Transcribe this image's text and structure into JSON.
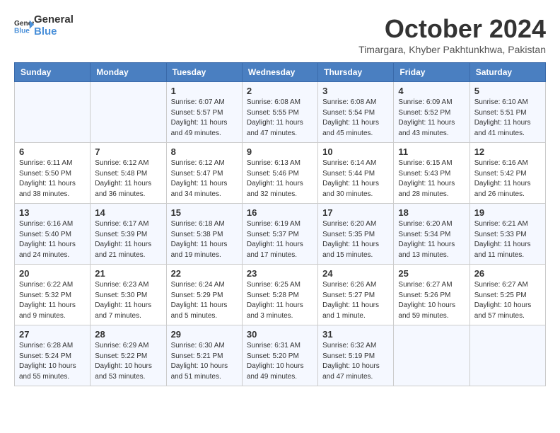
{
  "logo": {
    "text_general": "General",
    "text_blue": "Blue"
  },
  "title": "October 2024",
  "subtitle": "Timargara, Khyber Pakhtunkhwa, Pakistan",
  "days_of_week": [
    "Sunday",
    "Monday",
    "Tuesday",
    "Wednesday",
    "Thursday",
    "Friday",
    "Saturday"
  ],
  "weeks": [
    [
      {
        "day": "",
        "info": ""
      },
      {
        "day": "",
        "info": ""
      },
      {
        "day": "1",
        "info": "Sunrise: 6:07 AM\nSunset: 5:57 PM\nDaylight: 11 hours and 49 minutes."
      },
      {
        "day": "2",
        "info": "Sunrise: 6:08 AM\nSunset: 5:55 PM\nDaylight: 11 hours and 47 minutes."
      },
      {
        "day": "3",
        "info": "Sunrise: 6:08 AM\nSunset: 5:54 PM\nDaylight: 11 hours and 45 minutes."
      },
      {
        "day": "4",
        "info": "Sunrise: 6:09 AM\nSunset: 5:52 PM\nDaylight: 11 hours and 43 minutes."
      },
      {
        "day": "5",
        "info": "Sunrise: 6:10 AM\nSunset: 5:51 PM\nDaylight: 11 hours and 41 minutes."
      }
    ],
    [
      {
        "day": "6",
        "info": "Sunrise: 6:11 AM\nSunset: 5:50 PM\nDaylight: 11 hours and 38 minutes."
      },
      {
        "day": "7",
        "info": "Sunrise: 6:12 AM\nSunset: 5:48 PM\nDaylight: 11 hours and 36 minutes."
      },
      {
        "day": "8",
        "info": "Sunrise: 6:12 AM\nSunset: 5:47 PM\nDaylight: 11 hours and 34 minutes."
      },
      {
        "day": "9",
        "info": "Sunrise: 6:13 AM\nSunset: 5:46 PM\nDaylight: 11 hours and 32 minutes."
      },
      {
        "day": "10",
        "info": "Sunrise: 6:14 AM\nSunset: 5:44 PM\nDaylight: 11 hours and 30 minutes."
      },
      {
        "day": "11",
        "info": "Sunrise: 6:15 AM\nSunset: 5:43 PM\nDaylight: 11 hours and 28 minutes."
      },
      {
        "day": "12",
        "info": "Sunrise: 6:16 AM\nSunset: 5:42 PM\nDaylight: 11 hours and 26 minutes."
      }
    ],
    [
      {
        "day": "13",
        "info": "Sunrise: 6:16 AM\nSunset: 5:40 PM\nDaylight: 11 hours and 24 minutes."
      },
      {
        "day": "14",
        "info": "Sunrise: 6:17 AM\nSunset: 5:39 PM\nDaylight: 11 hours and 21 minutes."
      },
      {
        "day": "15",
        "info": "Sunrise: 6:18 AM\nSunset: 5:38 PM\nDaylight: 11 hours and 19 minutes."
      },
      {
        "day": "16",
        "info": "Sunrise: 6:19 AM\nSunset: 5:37 PM\nDaylight: 11 hours and 17 minutes."
      },
      {
        "day": "17",
        "info": "Sunrise: 6:20 AM\nSunset: 5:35 PM\nDaylight: 11 hours and 15 minutes."
      },
      {
        "day": "18",
        "info": "Sunrise: 6:20 AM\nSunset: 5:34 PM\nDaylight: 11 hours and 13 minutes."
      },
      {
        "day": "19",
        "info": "Sunrise: 6:21 AM\nSunset: 5:33 PM\nDaylight: 11 hours and 11 minutes."
      }
    ],
    [
      {
        "day": "20",
        "info": "Sunrise: 6:22 AM\nSunset: 5:32 PM\nDaylight: 11 hours and 9 minutes."
      },
      {
        "day": "21",
        "info": "Sunrise: 6:23 AM\nSunset: 5:30 PM\nDaylight: 11 hours and 7 minutes."
      },
      {
        "day": "22",
        "info": "Sunrise: 6:24 AM\nSunset: 5:29 PM\nDaylight: 11 hours and 5 minutes."
      },
      {
        "day": "23",
        "info": "Sunrise: 6:25 AM\nSunset: 5:28 PM\nDaylight: 11 hours and 3 minutes."
      },
      {
        "day": "24",
        "info": "Sunrise: 6:26 AM\nSunset: 5:27 PM\nDaylight: 11 hours and 1 minute."
      },
      {
        "day": "25",
        "info": "Sunrise: 6:27 AM\nSunset: 5:26 PM\nDaylight: 10 hours and 59 minutes."
      },
      {
        "day": "26",
        "info": "Sunrise: 6:27 AM\nSunset: 5:25 PM\nDaylight: 10 hours and 57 minutes."
      }
    ],
    [
      {
        "day": "27",
        "info": "Sunrise: 6:28 AM\nSunset: 5:24 PM\nDaylight: 10 hours and 55 minutes."
      },
      {
        "day": "28",
        "info": "Sunrise: 6:29 AM\nSunset: 5:22 PM\nDaylight: 10 hours and 53 minutes."
      },
      {
        "day": "29",
        "info": "Sunrise: 6:30 AM\nSunset: 5:21 PM\nDaylight: 10 hours and 51 minutes."
      },
      {
        "day": "30",
        "info": "Sunrise: 6:31 AM\nSunset: 5:20 PM\nDaylight: 10 hours and 49 minutes."
      },
      {
        "day": "31",
        "info": "Sunrise: 6:32 AM\nSunset: 5:19 PM\nDaylight: 10 hours and 47 minutes."
      },
      {
        "day": "",
        "info": ""
      },
      {
        "day": "",
        "info": ""
      }
    ]
  ]
}
